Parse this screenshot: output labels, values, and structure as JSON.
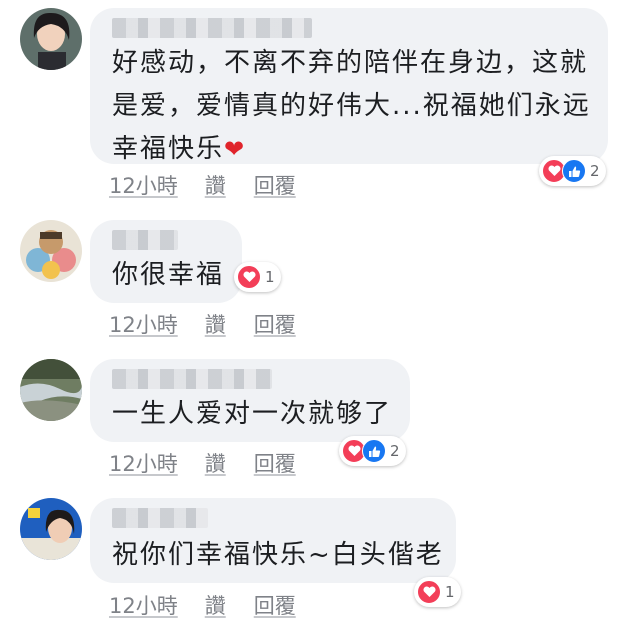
{
  "comments": [
    {
      "text": "好感动，不离不弃的陪伴在身边，这就\n是爱，爱情真的好伟大...祝福她们永远\n幸福快乐",
      "emoji": "❤",
      "time": "12小時",
      "like_label": "讚",
      "reply_label": "回覆",
      "reactions": [
        "heart",
        "like"
      ],
      "reaction_count": "2"
    },
    {
      "text": "你很幸福",
      "time": "12小時",
      "like_label": "讚",
      "reply_label": "回覆",
      "reactions": [
        "heart"
      ],
      "reaction_count": "1"
    },
    {
      "text": "一生人爱对一次就够了",
      "time": "12小時",
      "like_label": "讚",
      "reply_label": "回覆",
      "reactions": [
        "heart",
        "like"
      ],
      "reaction_count": "2"
    },
    {
      "text": "祝你们幸福快乐~白头偕老",
      "time": "12小時",
      "like_label": "讚",
      "reply_label": "回覆",
      "reactions": [
        "heart"
      ],
      "reaction_count": "1"
    }
  ],
  "colors": {
    "heart": "#f33e58",
    "like": "#1877f2",
    "bubble": "#f0f2f5"
  }
}
